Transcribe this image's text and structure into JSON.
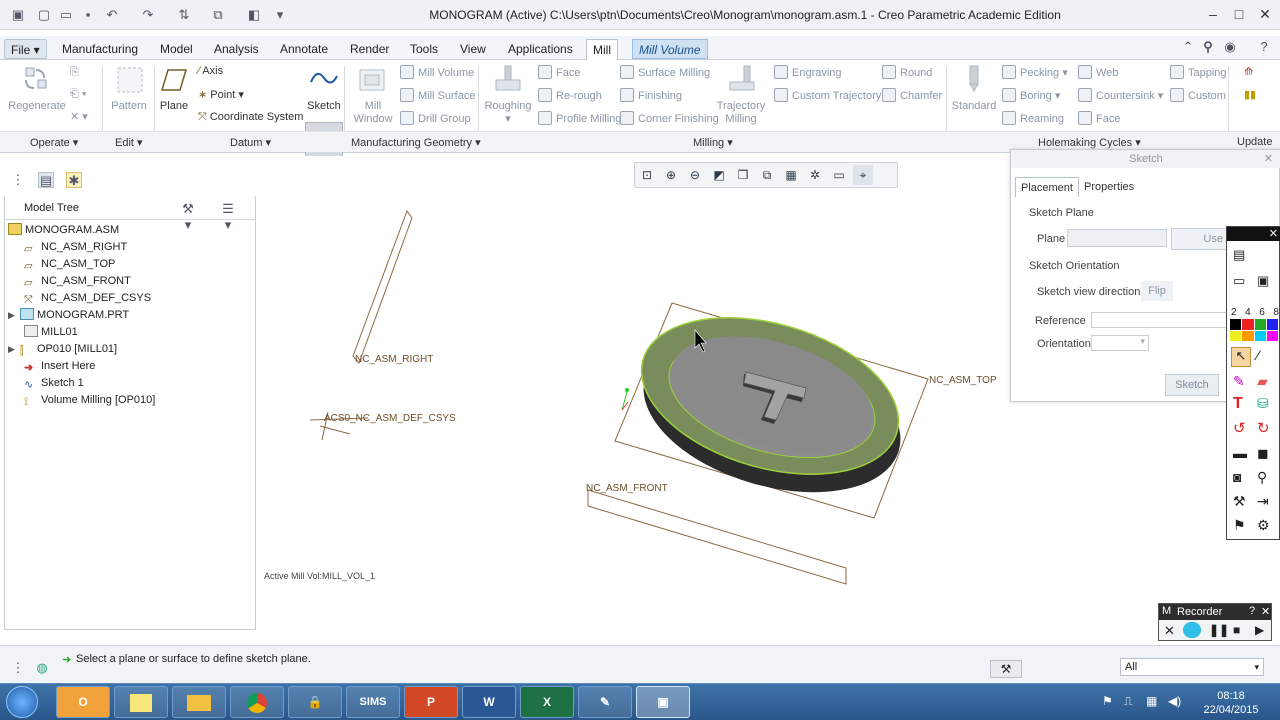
{
  "window": {
    "title": "MONOGRAM (Active) C:\\Users\\ptn\\Documents\\Creo\\Monogram\\monogram.asm.1 - Creo Parametric Academic Edition"
  },
  "tabs": [
    "File",
    "Manufacturing",
    "Model",
    "Analysis",
    "Annotate",
    "Render",
    "Tools",
    "View",
    "Applications",
    "Mill",
    "Mill Volume"
  ],
  "active_tab": "Mill",
  "ribbon": {
    "regenerate": "Regenerate",
    "pattern": "Pattern",
    "plane": "Plane",
    "axis": "Axis",
    "point": "Point",
    "csys": "Coordinate System",
    "sketch": "Sketch",
    "mill_window": "Mill Window",
    "mill_volume": "Mill Volume",
    "mill_surface": "Mill Surface",
    "drill_group": "Drill Group",
    "roughing": "Roughing",
    "face": "Face",
    "re_rough": "Re-rough",
    "profile_milling": "Profile Milling",
    "surface_milling": "Surface Milling",
    "finishing": "Finishing",
    "corner_finishing": "Corner Finishing",
    "trajectory_milling": "Trajectory Milling",
    "engraving": "Engraving",
    "custom_trajectory": "Custom Trajectory",
    "round": "Round",
    "chamfer": "Chamfer",
    "standard": "Standard",
    "pecking": "Pecking",
    "boring": "Boring",
    "reaming": "Reaming",
    "web": "Web",
    "countersink": "Countersink",
    "face2": "Face",
    "tapping": "Tapping",
    "custom": "Custom",
    "groups": {
      "operate": "Operate",
      "edit": "Edit",
      "datum": "Datum",
      "mfg_geometry": "Manufacturing Geometry",
      "milling": "Milling",
      "holemaking": "Holemaking Cycles",
      "update": "Update"
    }
  },
  "model_tree": {
    "header": "Model Tree",
    "items": [
      {
        "label": "MONOGRAM.ASM"
      },
      {
        "label": "NC_ASM_RIGHT"
      },
      {
        "label": "NC_ASM_TOP"
      },
      {
        "label": "NC_ASM_FRONT"
      },
      {
        "label": "NC_ASM_DEF_CSYS"
      },
      {
        "label": "MONOGRAM.PRT"
      },
      {
        "label": "MILL01"
      },
      {
        "label": "OP010 [MILL01]"
      },
      {
        "label": "Insert Here"
      },
      {
        "label": "Sketch 1"
      },
      {
        "label": "Volume Milling [OP010]"
      }
    ]
  },
  "viewport": {
    "labels": {
      "right": "NC_ASM_RIGHT",
      "csys": "ACS0_NC_ASM_DEF_CSYS",
      "top": "NC_ASM_TOP",
      "front": "NC_ASM_FRONT",
      "active": "Active Mill Vol:MILL_VOL_1"
    }
  },
  "sketch_dialog": {
    "title": "Sketch",
    "tabs": [
      "Placement",
      "Properties"
    ],
    "sketch_plane": "Sketch Plane",
    "plane_label": "Plane",
    "use_prev": "Use Prev",
    "orientation_header": "Sketch Orientation",
    "view_direction": "Sketch view direction",
    "flip": "Flip",
    "reference": "Reference",
    "orientation": "Orientation",
    "sketch_button": "Sketch"
  },
  "palette": {
    "numbers": [
      "2",
      "4",
      "6",
      "8"
    ]
  },
  "recorder": {
    "title": "Recorder",
    "help": "?"
  },
  "status": {
    "message": "Select a plane or surface to define sketch plane.",
    "filter": "All"
  },
  "taskbar": {
    "sims": "SIMS",
    "time": "08:18",
    "date": "22/04/2015"
  },
  "colors": {
    "ribbon_bg": "#ffffff",
    "context_tab": "#cfe2f3",
    "taskbar": "#2a568a",
    "model_green": "#7b8c5c",
    "model_gray": "#8a8a8a"
  }
}
